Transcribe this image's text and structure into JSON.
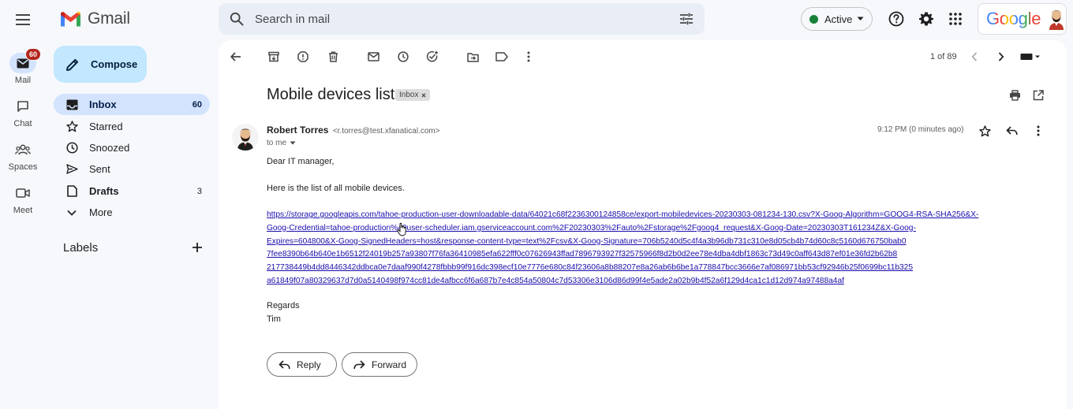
{
  "app": {
    "name": "Gmail"
  },
  "rail": {
    "items": [
      {
        "label": "Mail",
        "badge": "60"
      },
      {
        "label": "Chat"
      },
      {
        "label": "Spaces"
      },
      {
        "label": "Meet"
      }
    ]
  },
  "search": {
    "placeholder": "Search in mail",
    "value": ""
  },
  "status": {
    "label": "Active",
    "color": "#188038"
  },
  "account": {
    "brand": "Google"
  },
  "sidebar": {
    "compose_label": "Compose",
    "items": [
      {
        "label": "Inbox",
        "count": "60",
        "icon": "inbox-icon"
      },
      {
        "label": "Starred",
        "count": "",
        "icon": "star-icon"
      },
      {
        "label": "Snoozed",
        "count": "",
        "icon": "clock-icon"
      },
      {
        "label": "Sent",
        "count": "",
        "icon": "send-icon"
      },
      {
        "label": "Drafts",
        "count": "3",
        "icon": "draft-icon"
      },
      {
        "label": "More",
        "count": "",
        "icon": "chevron-down-icon"
      }
    ],
    "labels_heading": "Labels"
  },
  "toolbar": {
    "pager": "1 of 89"
  },
  "email": {
    "subject": "Mobile devices list",
    "folder_chip": "Inbox",
    "sender_name": "Robert Torres",
    "sender_email": "<r.torres@test.xfanatical.com>",
    "recipient": "to me",
    "timestamp": "9:12 PM (0 minutes ago)",
    "greeting": "Dear IT manager,",
    "intro": "Here is the list of all mobile devices.",
    "link_lines": [
      "https://storage.googleapis.com/tahoe-production-user-downloadable-data/64021c68f2236300124858ce/export-mobiledevices-20230303-081234-130.csv?X-Goog-Algorithm=GOOG4-RSA-SHA256&X-",
      "Goog-Credential=tahoe-production%40user-scheduler.iam.gserviceaccount.com%2F20230303%2Fauto%2Fstorage%2Fgoog4_request&X-Goog-Date=20230303T161234Z&X-Goog-",
      "Expires=604800&X-Goog-SignedHeaders=host&response-content-type=text%2Fcsv&X-Goog-Signature=706b5240d5c4f4a3b96db731c310e8d05cb4b74d60c8c5160d676750bab0",
      "7fee8390b64b640e1b6512f24019b257a93807f76fa36410985efa622fff0c07626943ffad7896793927f32575966f8d2b0d2ee78e4dba4dbf1863c73d49c0aff643d87ef01e36fd2b62b8",
      "217738449b4dd8446342ddbca0e7daaf990f4278fbbb99f916dc398ecf10e7776e680c84f23606a8b88207e8a26ab6b6be1a778847bcc3666e7af086971bb53cf92946b25f0699bc11b325",
      "a61849f07a80329637d7d0a5140498f974cc81de4afbcc6f6a687b7e4c854a50804c7d53306e3106d86d99f4e5ade2a02b9b4f52a6f129d4ca1c1d12d974a97488a4af"
    ],
    "signoff": "Regards",
    "signature": "Tim",
    "reply_label": "Reply",
    "forward_label": "Forward"
  }
}
